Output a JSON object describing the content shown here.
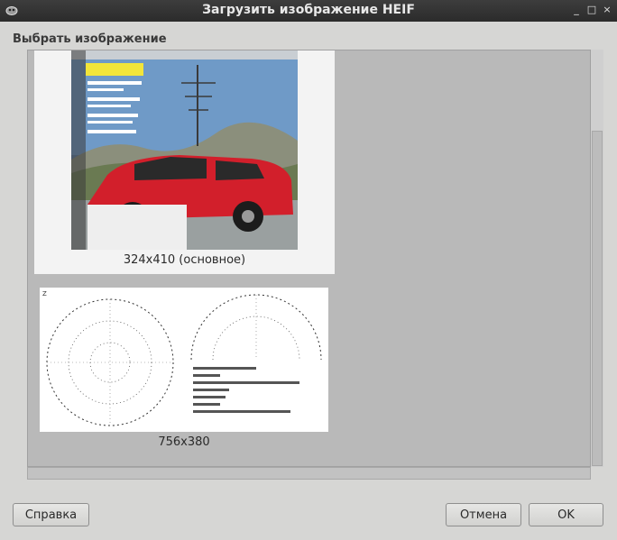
{
  "window": {
    "title": "Загрузить изображение HEIF",
    "controls": {
      "minimize": "_",
      "maximize": "□",
      "close": "×"
    }
  },
  "section": {
    "label": "Выбрать изображение"
  },
  "images": [
    {
      "caption": "324x410 (основное)",
      "selected": true
    },
    {
      "caption": "756x380",
      "selected": false
    }
  ],
  "buttons": {
    "help": "Справка",
    "cancel": "Отмена",
    "ok": "OK"
  },
  "colors": {
    "titlebar": "#2f2f2f",
    "panel": "#b9b9b9",
    "dialog": "#d6d6d4"
  },
  "icons": [
    "app-icon",
    "minimize-icon",
    "maximize-icon",
    "close-icon"
  ]
}
